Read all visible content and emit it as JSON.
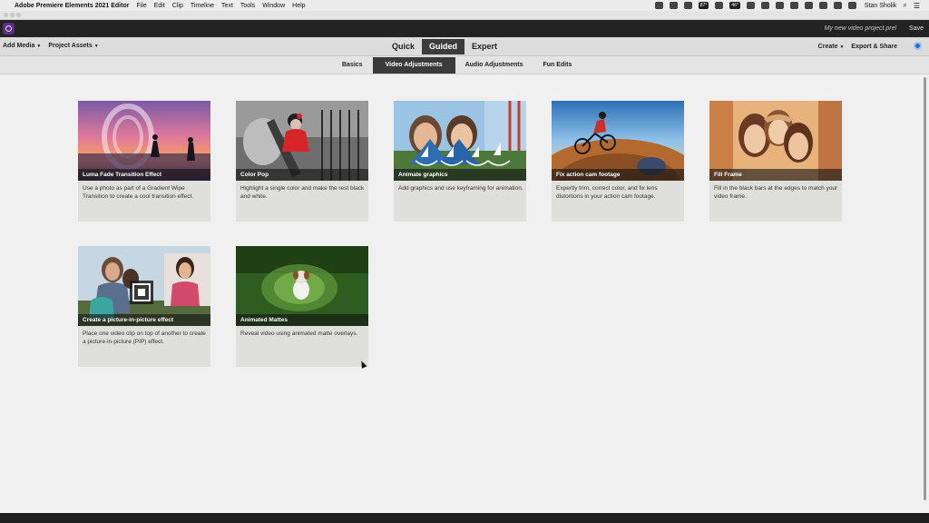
{
  "menubar": {
    "app_name": "Adobe Premiere Elements 2021 Editor",
    "items": [
      "File",
      "Edit",
      "Clip",
      "Timeline",
      "Text",
      "Tools",
      "Window",
      "Help"
    ],
    "status_pills": [
      "87°",
      "46°"
    ],
    "user": "Stan Sholik"
  },
  "header": {
    "project_name": "My new video project.prel",
    "save_label": "Save"
  },
  "modebar": {
    "add_media": "Add Media",
    "project_assets": "Project Assets",
    "modes": [
      "Quick",
      "Guided",
      "Expert"
    ],
    "active_mode": "Guided",
    "create": "Create",
    "export_share": "Export & Share"
  },
  "tabs": {
    "items": [
      "Basics",
      "Video Adjustments",
      "Audio Adjustments",
      "Fun Edits"
    ],
    "active": "Video Adjustments"
  },
  "cards": [
    {
      "title": "Luma Fade Transition Effect",
      "desc": "Use a photo as part of a Gradient Wipe Transition to create a cool transition effect."
    },
    {
      "title": "Color Pop",
      "desc": "Highlight a single color and make the rest black and white."
    },
    {
      "title": "Animate graphics",
      "desc": "Add graphics and use keyframing for animation."
    },
    {
      "title": "Fix action cam footage",
      "desc": "Expertly trim, correct color, and fix lens distortions in your action cam footage."
    },
    {
      "title": "Fill Frame",
      "desc": "Fill in the black bars at the edges to match your video frame."
    },
    {
      "title": "Create a picture-in-picture effect",
      "desc": "Place one video clip on top of another to create a picture-in-picture (PIP) effect."
    },
    {
      "title": "Animated Mattes",
      "desc": "Reveal video using animated matte overlays."
    }
  ],
  "colors": {
    "header_bg": "#232323",
    "active_tab": "#3a3a3a",
    "card_bg": "#dfdfdb",
    "accent_blue": "#2a6bd1"
  }
}
